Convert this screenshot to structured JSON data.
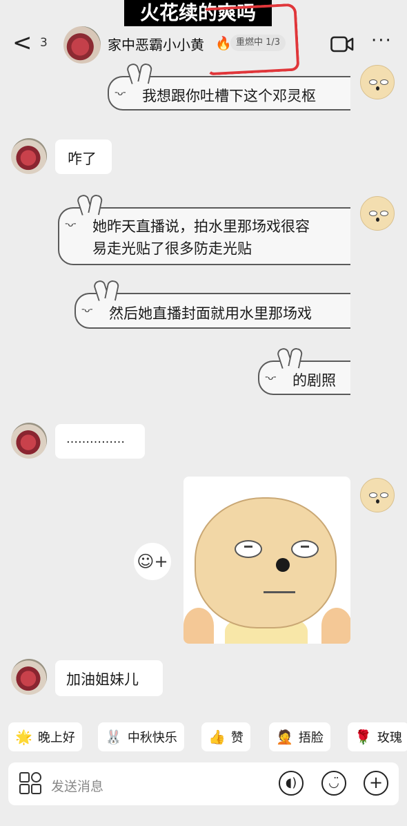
{
  "overlay": {
    "caption": "火花续的爽吗"
  },
  "header": {
    "back": "<",
    "unread_count": "3",
    "contact_name": "家中恶霸小小黄",
    "streak_label": "重燃中 1/3",
    "more": "···"
  },
  "messages": [
    {
      "side": "me",
      "text": "我想跟你吐槽下这个邓灵枢"
    },
    {
      "side": "other",
      "text": "咋了"
    },
    {
      "side": "me",
      "line1": "她昨天直播说，拍水里那场戏很容",
      "line2": "易走光贴了很多防走光贴"
    },
    {
      "side": "me",
      "text": "然后她直播封面就用水里那场戏"
    },
    {
      "side": "me",
      "text": "的剧照"
    },
    {
      "side": "other",
      "text": "……………"
    },
    {
      "side": "me",
      "type": "sticker"
    },
    {
      "side": "other",
      "text": "加油姐妹儿"
    }
  ],
  "bubble_face": "-ᴗ-",
  "quick_replies": [
    {
      "label": "晚上好",
      "icon": "star-face-icon"
    },
    {
      "label": "中秋快乐",
      "icon": "rabbit-icon"
    },
    {
      "label": "赞",
      "icon": "thumbs-up-icon"
    },
    {
      "label": "捂脸",
      "icon": "facepalm-icon"
    },
    {
      "label": "玫瑰",
      "icon": "rose-icon"
    }
  ],
  "input": {
    "placeholder": "发送消息"
  },
  "colors": {
    "background": "#ededed",
    "bubble_border": "#5a5a5a",
    "mark_red": "#e0363a"
  }
}
